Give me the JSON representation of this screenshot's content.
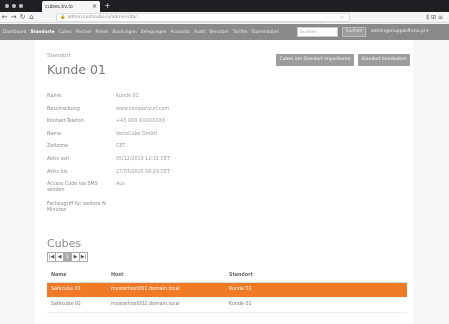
{
  "browser": {
    "tab_title": "cubes.kv.io",
    "tab_close": "×",
    "new_tab": "+",
    "url": "admin.kuchcube.io/admin/site/...",
    "url_right_icons": "··· ☆",
    "right_icons": "⫼ ⊞ ≡"
  },
  "appnav": {
    "items": [
      "Dashboard",
      "Standorte",
      "Cubes",
      "Partner",
      "Preise",
      "Buchungen",
      "Belegungen",
      "Accounts",
      "Audit",
      "Benutzer",
      "Tarifire",
      "Stammdaten"
    ],
    "active_index": 1,
    "search_placeholder": "Suchen",
    "search_button": "Suchen",
    "user": "admin@muppasfirma.pl ▾"
  },
  "header": {
    "crumb": "Standort",
    "title": "Kunde 01",
    "import_button": "Cubes am Standort importieren",
    "edit_button": "Standort bearbeiten"
  },
  "properties": [
    {
      "label": "Name",
      "value": "Kunde 01"
    },
    {
      "label": "Beschreibung",
      "value": "www.companyurl.com"
    },
    {
      "label": "Kontakt-Telefon",
      "value": "+43 XXX XXXXXXXX"
    },
    {
      "label": "Name",
      "value": "VarioCube GmbH"
    },
    {
      "label": "Zeitzone",
      "value": "CET"
    },
    {
      "label": "Aktiv seit",
      "value": "05/12/2019 12:31 CET"
    },
    {
      "label": "Aktiv bis",
      "value": "27/03/2025 08:29 CET"
    },
    {
      "label": "Access Code via SMS senden",
      "value": "Aus"
    },
    {
      "label": "Fachzugriff für weitere N Minuten",
      "value": ""
    }
  ],
  "cubes": {
    "title": "Cubes",
    "pager": [
      "|◀",
      "◀",
      "1",
      "▶",
      "▶|"
    ],
    "columns": [
      "Name",
      "Host",
      "Standort"
    ],
    "rows": [
      [
        "Safecube 01",
        "musterhost001.domain.local",
        "Kunde 01"
      ],
      [
        "Safecube 02",
        "musterhost002.domain.local",
        "Kunde 01"
      ]
    ]
  },
  "colors": {
    "accent": "#f07a26",
    "nav": "#8a8a8a"
  }
}
